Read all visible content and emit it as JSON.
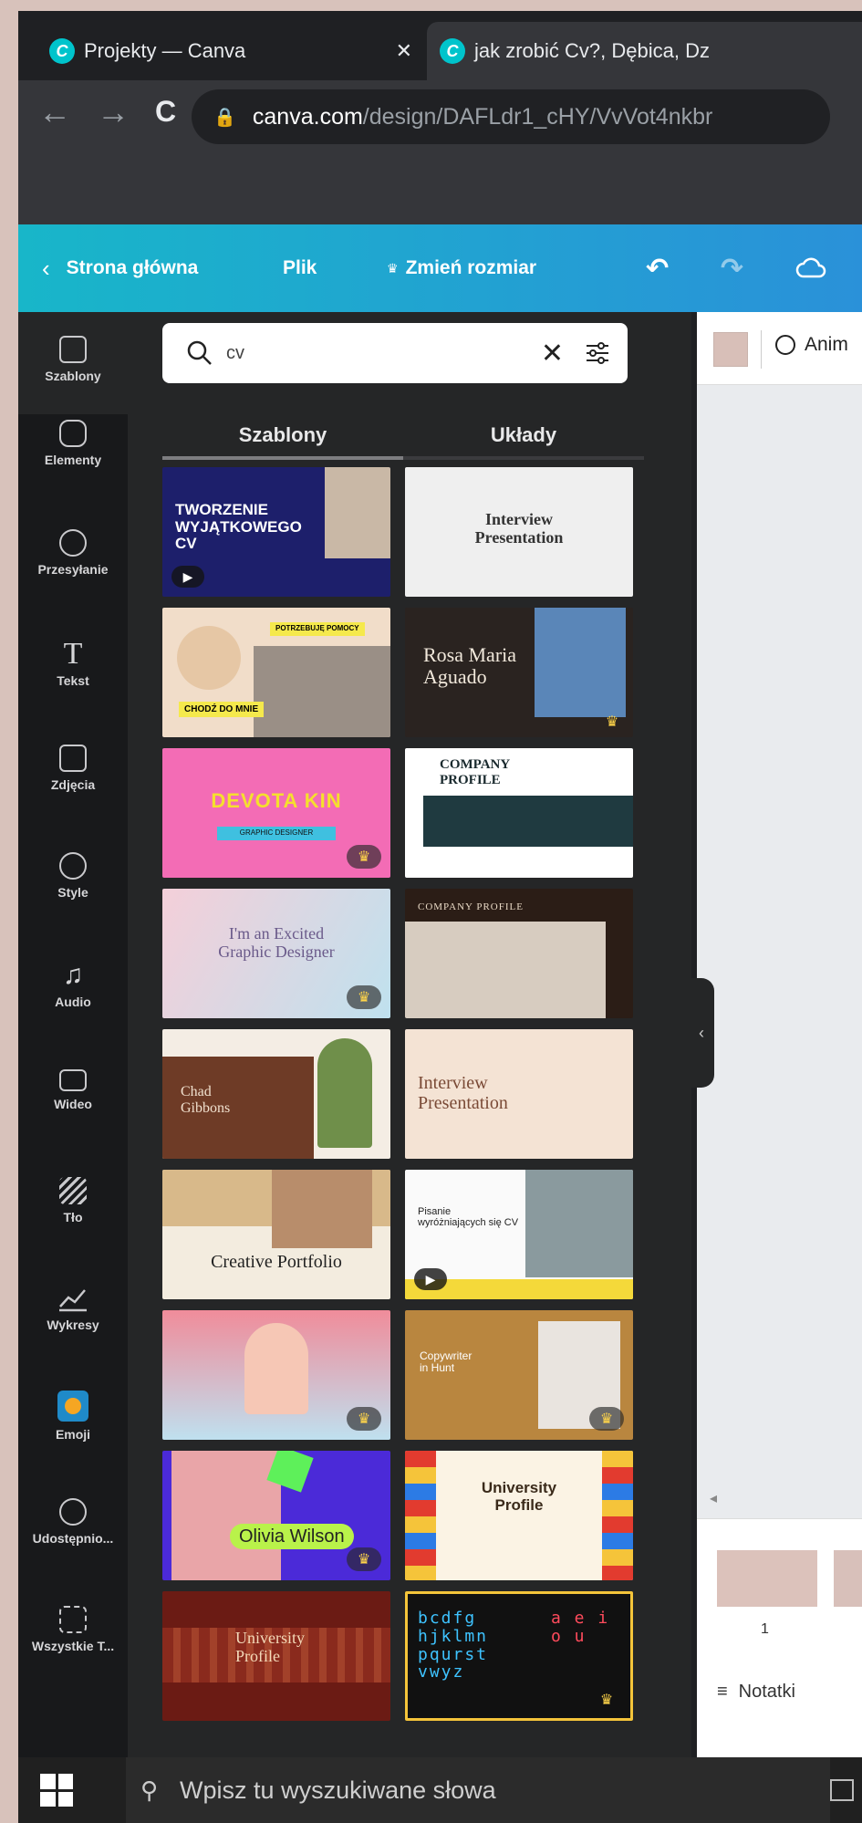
{
  "browser": {
    "tabs": [
      {
        "title": "Projekty — Canva",
        "close": "✕",
        "active": false
      },
      {
        "title": "jak zrobić Cv?, Dębica, Dz",
        "active": true
      }
    ],
    "url_domain": "canva.com",
    "url_path": "/design/DAFLdr1_cHY/VvVot4nkbr"
  },
  "canva_header": {
    "back_label": "Strona główna",
    "file_label": "Plik",
    "resize_label": "Zmień rozmiar"
  },
  "rail": {
    "items": [
      {
        "label": "Szablony",
        "icon": "templates-icon"
      },
      {
        "label": "Elementy",
        "icon": "elements-icon"
      },
      {
        "label": "Przesyłanie",
        "icon": "upload-cloud-icon"
      },
      {
        "label": "Tekst",
        "icon": "text-icon"
      },
      {
        "label": "Zdjęcia",
        "icon": "photos-icon"
      },
      {
        "label": "Style",
        "icon": "palette-icon"
      },
      {
        "label": "Audio",
        "icon": "music-note-icon"
      },
      {
        "label": "Wideo",
        "icon": "video-icon"
      },
      {
        "label": "Tło",
        "icon": "background-pattern-icon"
      },
      {
        "label": "Wykresy",
        "icon": "chart-icon"
      },
      {
        "label": "Emoji",
        "icon": "emoji-icon"
      },
      {
        "label": "Udostępnio...",
        "icon": "shared-users-icon"
      },
      {
        "label": "Wszystkie T...",
        "icon": "all-apps-icon"
      }
    ]
  },
  "panel": {
    "search_value": "cv",
    "tabs": [
      "Szablony",
      "Układy"
    ],
    "templates": [
      {
        "lines": [
          "TWORZENIE",
          "WYJĄTKOWEGO",
          "CV"
        ],
        "bg": "#1d1f6b",
        "fg": "#ffffff"
      },
      {
        "lines": [
          "Interview",
          "Presentation"
        ],
        "bg": "#efefef",
        "fg": "#333333"
      },
      {
        "lines": [
          "POTRZEBUJĘ POMOCY",
          "CHODŹ DO MNIE"
        ],
        "bg": "#f1ddc9",
        "fg": "#222222"
      },
      {
        "lines": [
          "Rosa Maria",
          "Aguado"
        ],
        "bg": "#2a2320",
        "fg": "#f2e9dc"
      },
      {
        "lines": [
          "DEVOTA KIN",
          "GRAPHIC DESIGNER"
        ],
        "bg": "#f36cb5",
        "fg": "#f5e02d"
      },
      {
        "lines": [
          "COMPANY",
          "PROFILE"
        ],
        "bg": "#ffffff",
        "fg": "#1a2a2e"
      },
      {
        "lines": [
          "I'm an Excited",
          "Graphic Designer"
        ],
        "bg": "#f4cfd9",
        "fg": "#6a5a8a"
      },
      {
        "lines": [
          "COMPANY PROFILE"
        ],
        "bg": "#2b1d16",
        "fg": "#e8d9c5"
      },
      {
        "lines": [
          "Chad",
          "Gibbons"
        ],
        "bg": "#f4ede4",
        "fg": "#f1e1cf"
      },
      {
        "lines": [
          "Interview",
          "Presentation"
        ],
        "bg": "#f4e3d4",
        "fg": "#7a4a36"
      },
      {
        "lines": [
          "Creative Portfolio"
        ],
        "bg": "#f3ecdf",
        "fg": "#222222"
      },
      {
        "lines": [
          "Pisanie",
          "wyróżniających się CV"
        ],
        "bg": "#fafafa",
        "fg": "#222222"
      },
      {
        "lines": [],
        "bg": "#f2b8c0",
        "fg": "#ffffff"
      },
      {
        "lines": [
          "Copywriter",
          "in Hunt"
        ],
        "bg": "#b9863f",
        "fg": "#ffffff"
      },
      {
        "lines": [
          "Olivia Wilson"
        ],
        "bg": "#4b2ad8",
        "fg": "#ffffff"
      },
      {
        "lines": [
          "University",
          "Profile"
        ],
        "bg": "#fbf3e4",
        "fg": "#3a2a1a"
      },
      {
        "lines": [
          "University",
          "Profile"
        ],
        "bg": "#6b1b14",
        "fg": "#f3d9b8"
      },
      {
        "lines": [
          "bcdfg",
          "hjklmn",
          "pqurst",
          "vwyz",
          "a e i",
          "o u"
        ],
        "bg": "#111111",
        "fg": "#3ec3ff"
      }
    ]
  },
  "canvas": {
    "toolbar_label": "Anim",
    "page_number": "1",
    "notes_label": "Notatki"
  },
  "taskbar": {
    "search_placeholder": "Wpisz tu wyszukiwane słowa"
  }
}
